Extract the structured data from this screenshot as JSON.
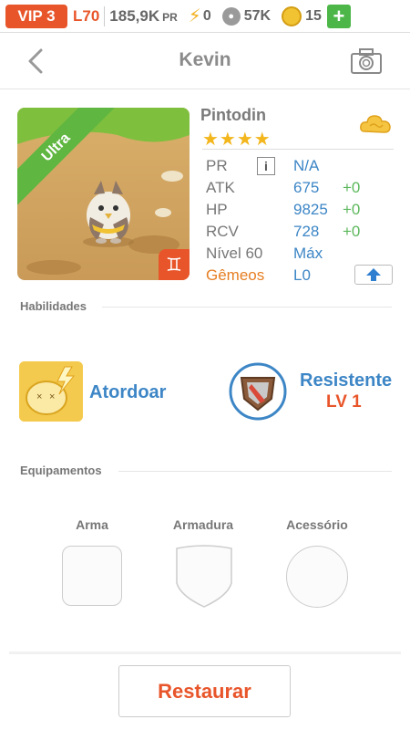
{
  "statusbar": {
    "vip": "VIP 3",
    "level": "L70",
    "power": "185,9K",
    "power_unit": "PR",
    "energy": "0",
    "paws": "57K",
    "coins": "15",
    "add": "+"
  },
  "header": {
    "title": "Kevin"
  },
  "pet": {
    "rarity": "Ultra",
    "name": "Pintodin",
    "stars": "★★★★",
    "zodiac": "♊",
    "stats": {
      "pr_label": "PR",
      "pr_value": "N/A",
      "atk_label": "ATK",
      "atk_value": "675",
      "atk_bonus": "+0",
      "hp_label": "HP",
      "hp_value": "9825",
      "hp_bonus": "+0",
      "rcv_label": "RCV",
      "rcv_value": "728",
      "rcv_bonus": "+0",
      "level_label": "Nível 60",
      "level_value": "Máx",
      "gemini_label": "Gêmeos",
      "gemini_value": "L0"
    }
  },
  "skills": {
    "title": "Habilidades",
    "active_name": "Atordoar",
    "passive_name": "Resistente",
    "passive_level": "LV 1"
  },
  "equipment": {
    "title": "Equipamentos",
    "weapon": "Arma",
    "armor": "Armadura",
    "accessory": "Acessório"
  },
  "actions": {
    "restore": "Restaurar"
  },
  "colors": {
    "accent": "#e8552a",
    "blue": "#3d86c6",
    "green": "#5cb85c",
    "gold": "#f3b61c"
  }
}
